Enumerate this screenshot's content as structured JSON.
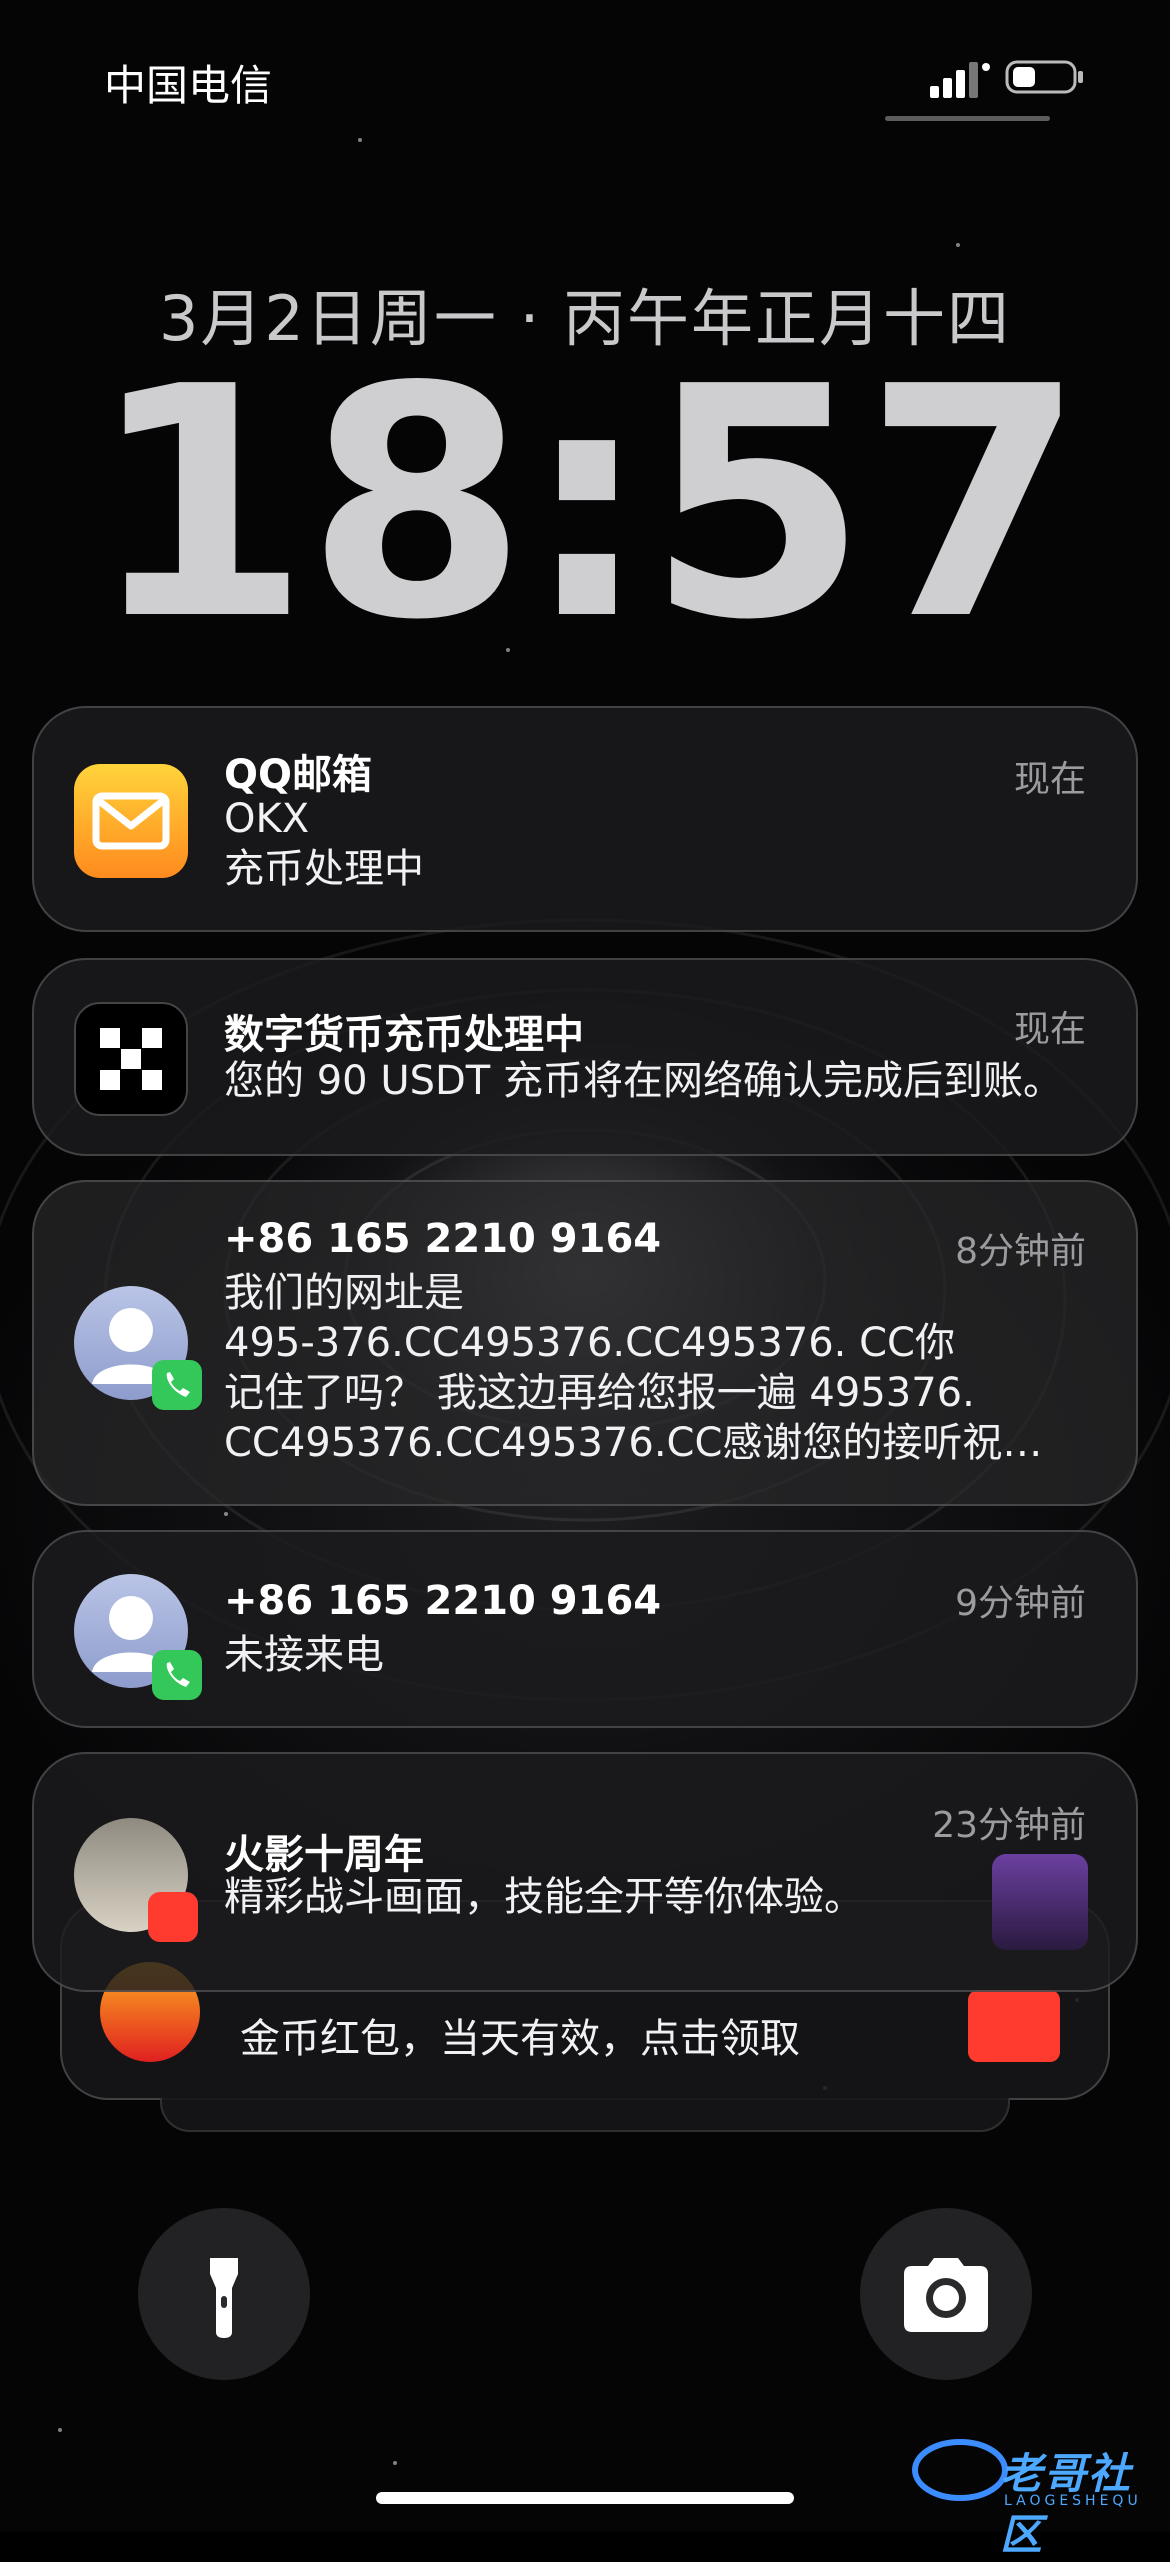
{
  "status": {
    "carrier": "中国电信"
  },
  "lock": {
    "date": "3月2日周一 · 丙午年正月十四",
    "time": "18:57"
  },
  "notifications": [
    {
      "app": "QQ邮箱",
      "icon": "mail-icon",
      "time": "现在",
      "lines": [
        "OKX",
        "充币处理中"
      ]
    },
    {
      "app": "数字货币充币处理中",
      "icon": "okx-icon",
      "time": "现在",
      "lines": [
        "您的 90 USDT 充币将在网络确认完成后到账。"
      ]
    },
    {
      "app": "+86 165 2210 9164",
      "icon": "contact-avatar-icon",
      "time": "8分钟前",
      "lines": [
        "我们的网址是",
        "495-376.CC495376.CC495376. CC你",
        "记住了吗？ 我这边再给您报一遍 495376.",
        "CC495376.CC495376.CC感谢您的接听祝…"
      ]
    },
    {
      "app": "+86 165 2210 9164",
      "icon": "contact-avatar-icon",
      "time": "9分钟前",
      "lines": [
        "未接来电"
      ]
    },
    {
      "app": "火影十周年",
      "icon": "game-avatar-icon",
      "time": "23分钟前",
      "lines": [
        "精彩战斗画面，技能全开等你体验。"
      ]
    }
  ],
  "stacked_notification": {
    "line": "金币红包，当天有效，点击领取"
  },
  "watermark": {
    "text": "老哥社区",
    "sub": "LAOGESHEQU"
  },
  "colors": {
    "background": "#000000",
    "card": "#1c1c1e",
    "accent_green": "#34c759",
    "mail_yellow": "#ffd43a",
    "mail_orange": "#ff8a1e"
  }
}
